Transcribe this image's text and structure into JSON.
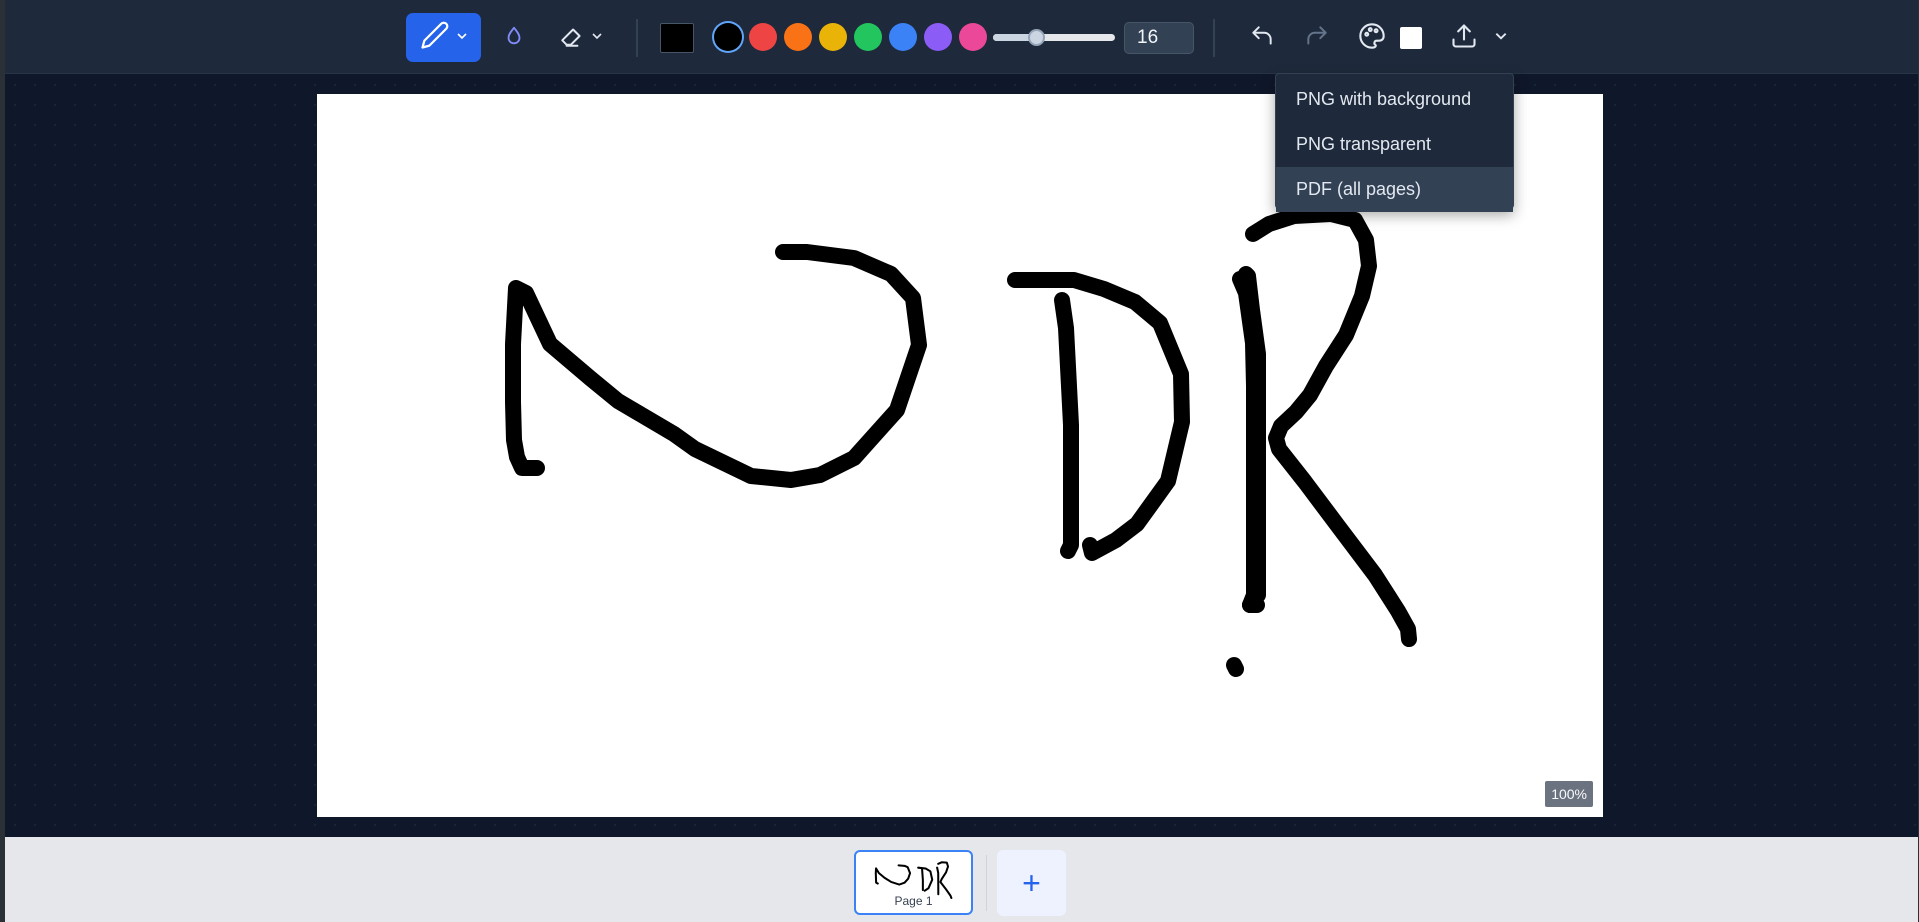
{
  "toolbar": {
    "tools": {
      "pen": "pen-icon",
      "highlighter": "highlighter-icon",
      "eraser": "eraser-icon"
    },
    "current_color": "#000000",
    "palette": [
      "#000000",
      "#ef4444",
      "#f97316",
      "#eab308",
      "#22c55e",
      "#3b82f6",
      "#8b5cf6",
      "#ec4899"
    ],
    "brush_size": "16",
    "brush_size_fraction": 0.33,
    "background_color": "#ffffff"
  },
  "export_menu": {
    "items": [
      "PNG with background",
      "PNG transparent",
      "PDF (all pages)"
    ],
    "hovered_index": 2
  },
  "canvas": {
    "zoom": "100%"
  },
  "pages": {
    "current_label": "Page 1",
    "add_label": "+"
  }
}
